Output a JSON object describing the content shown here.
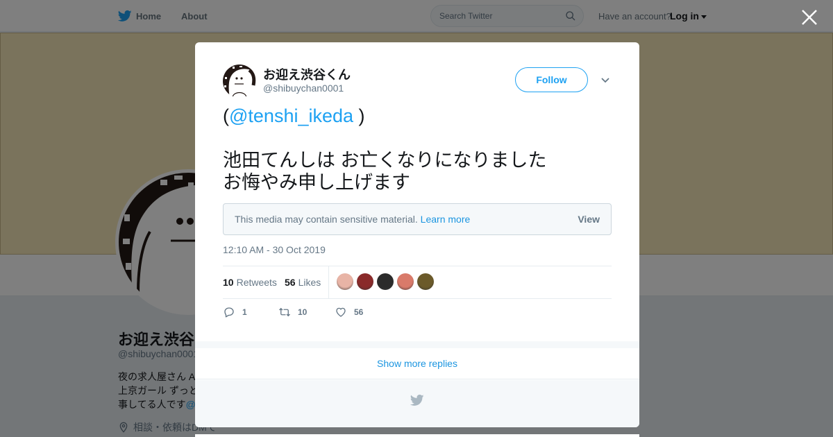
{
  "topbar": {
    "home_label": "Home",
    "about_label": "About",
    "search_placeholder": "Search Twitter",
    "account_prompt": "Have an account?",
    "login_label": "Log in"
  },
  "background_profile": {
    "name": "お迎え渋谷",
    "handle": "@shibuychan0001",
    "bio_lines": [
      "夜の求人屋さん A",
      "上京ガール ずっと",
      "事してる人です"
    ],
    "bio_link_fragment": "@",
    "location": "相談・依頼はDMで"
  },
  "tweet": {
    "author_name": "お迎え渋谷くん",
    "author_handle": "@shibuychan0001",
    "follow_label": "Follow",
    "text_open": "(",
    "mention": "@tenshi_ikeda",
    "text_close": " )",
    "line1": "池田てんしは お亡くなりになりました",
    "line2": "お悔やみ申し上げます",
    "sensitive_notice": "This media may contain sensitive material.",
    "learn_more": "Learn more",
    "view_label": "View",
    "timestamp": "12:10 AM - 30 Oct 2019",
    "retweets_count": "10",
    "retweets_label": "Retweets",
    "likes_count": "56",
    "likes_label": "Likes",
    "replies_action": "1",
    "retweets_action": "10",
    "likes_action": "56"
  },
  "facepile_colors": [
    "#e8b4a6",
    "#8a2a2a",
    "#2b2b2b",
    "#d97a6a",
    "#6b5a2a"
  ],
  "show_more_replies": "Show more replies",
  "colors": {
    "accent": "#1da1f2",
    "link": "#1b95e0",
    "muted": "#657786",
    "banner": "#f5e6b8"
  },
  "icons": [
    "twitter-bird-icon",
    "search-icon",
    "close-icon",
    "chevron-down-icon",
    "reply-icon",
    "retweet-icon",
    "like-icon",
    "location-pin-icon"
  ]
}
